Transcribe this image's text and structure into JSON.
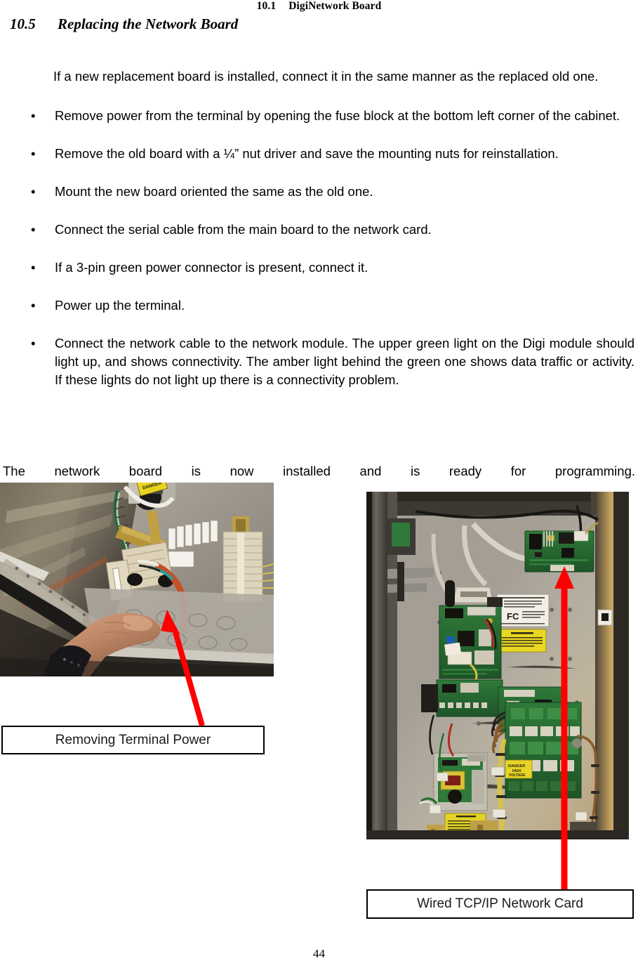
{
  "header": {
    "number": "10.1",
    "title": "DigiNetwork Board"
  },
  "section": {
    "number": "10.5",
    "title": "Replacing the Network Board"
  },
  "intro": "If a new replacement board is installed, connect it in the same manner as the replaced old one.",
  "bullets": [
    "Remove power from the terminal by opening the fuse block at the bottom left corner of the cabinet.",
    "Remove the old board with a ¼” nut driver and save the mounting nuts for reinstallation.",
    "Mount the new board oriented the same as the old one.",
    "Connect the serial cable from the main board to the network card.",
    "If a 3-pin green power connector is present, connect it.",
    "Power up the terminal.",
    "Connect the network cable to the network module. The upper green light on the Digi module should light up, and shows connectivity. The amber light behind the green one shows data traffic or activity. If these lights do not light up there is a connectivity problem."
  ],
  "bullet_marker": "•",
  "closing": "The network board is now installed and is ready for programming.",
  "figures": [
    {
      "caption": "Removing Terminal Power",
      "alt": "Photograph of cabinet interior showing a hand near the fuse block and terminal wiring",
      "arrow_color": "#FF0000"
    },
    {
      "caption": "Wired TCP/IP Network Card",
      "alt": "Photograph of open terminal cabinet showing green circuit boards, FCC label and yellow warning label",
      "arrow_color": "#FF0000"
    }
  ],
  "page_number": "44",
  "colors": {
    "arrow_red": "#FF0000",
    "text_black": "#000000",
    "caption_border": "#000000"
  }
}
